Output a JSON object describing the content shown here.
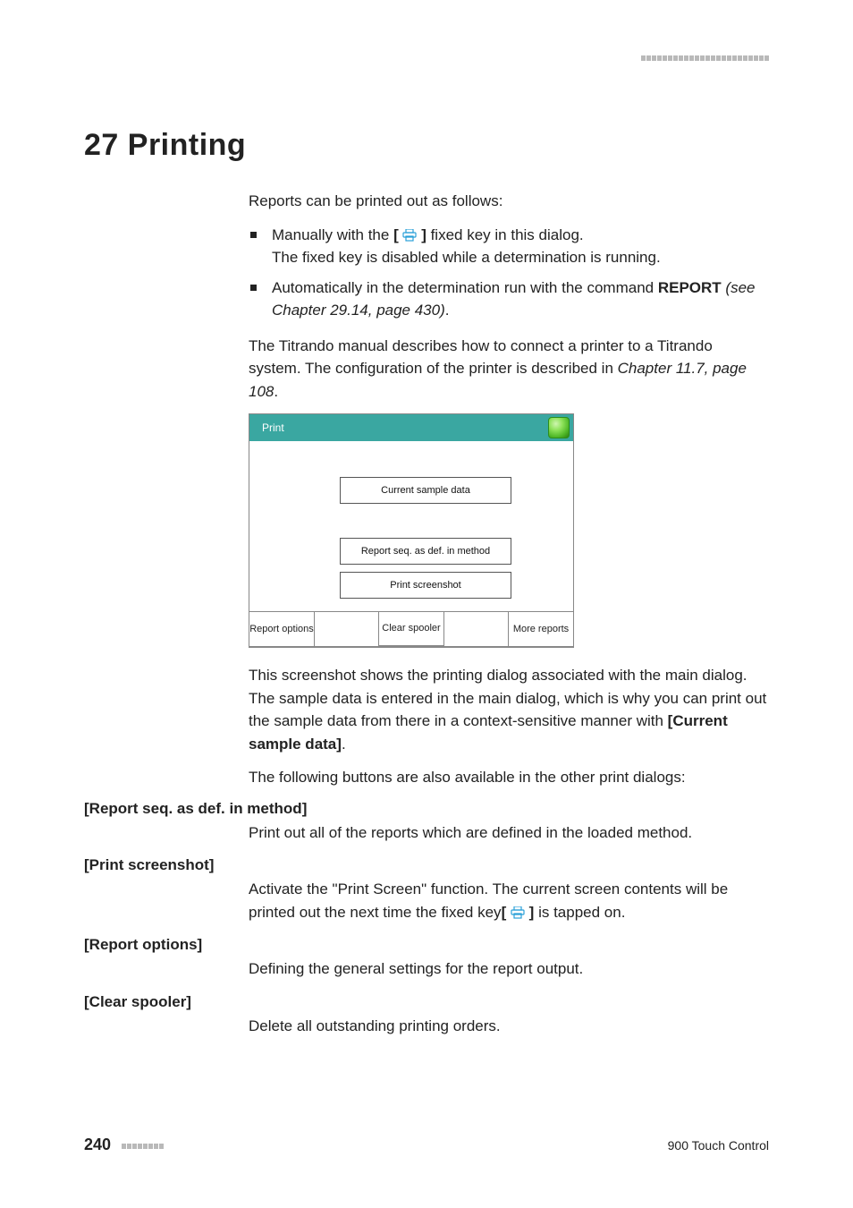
{
  "chapter_title": "27 Printing",
  "intro": "Reports can be printed out as follows:",
  "bullet1_a": "Manually with the ",
  "bullet1_b": " fixed key in this dialog.",
  "bullet1_line2": "The fixed key is disabled while a determination is running.",
  "bullet2_a": "Automatically in the determination run with the command ",
  "bullet2_b": "REPORT",
  "bullet2_c_italic": "(see Chapter 29.14, page 430)",
  "bullet2_period": ".",
  "para2_a": "The Titrando manual describes how to connect a printer to a Titrando system. The configuration of the printer is described in ",
  "para2_b_italic": "Chapter 11.7, page 108",
  "para2_period": ".",
  "device": {
    "title": "Print",
    "btn_current_sample": "Current sample data",
    "btn_report_seq": "Report seq. as def. in method",
    "btn_print_screenshot": "Print screenshot",
    "footer_left": "Report options",
    "footer_mid": "Clear spooler",
    "footer_right": "More reports"
  },
  "para3_a": "This screenshot shows the printing dialog associated with the main dialog. The sample data is entered in the main dialog, which is why you can print out the sample data from there in a context-sensitive manner with ",
  "para3_b_bold": "[Current sample data]",
  "para3_period": ".",
  "para4": "The following buttons are also available in the other print dialogs:",
  "defs": {
    "report_seq": {
      "term": "[Report seq. as def. in method]",
      "desc": "Print out all of the reports which are defined in the loaded method."
    },
    "print_screenshot": {
      "term": "[Print screenshot]",
      "desc_a": "Activate the \"Print Screen\" function. The current screen contents will be printed out the next time the fixed key",
      "desc_b": " is tapped on."
    },
    "report_options": {
      "term": "[Report options]",
      "desc": "Defining the general settings for the report output."
    },
    "clear_spooler": {
      "term": "[Clear spooler]",
      "desc": "Delete all outstanding printing orders."
    }
  },
  "footer": {
    "page_number": "240",
    "product": "900 Touch Control"
  }
}
